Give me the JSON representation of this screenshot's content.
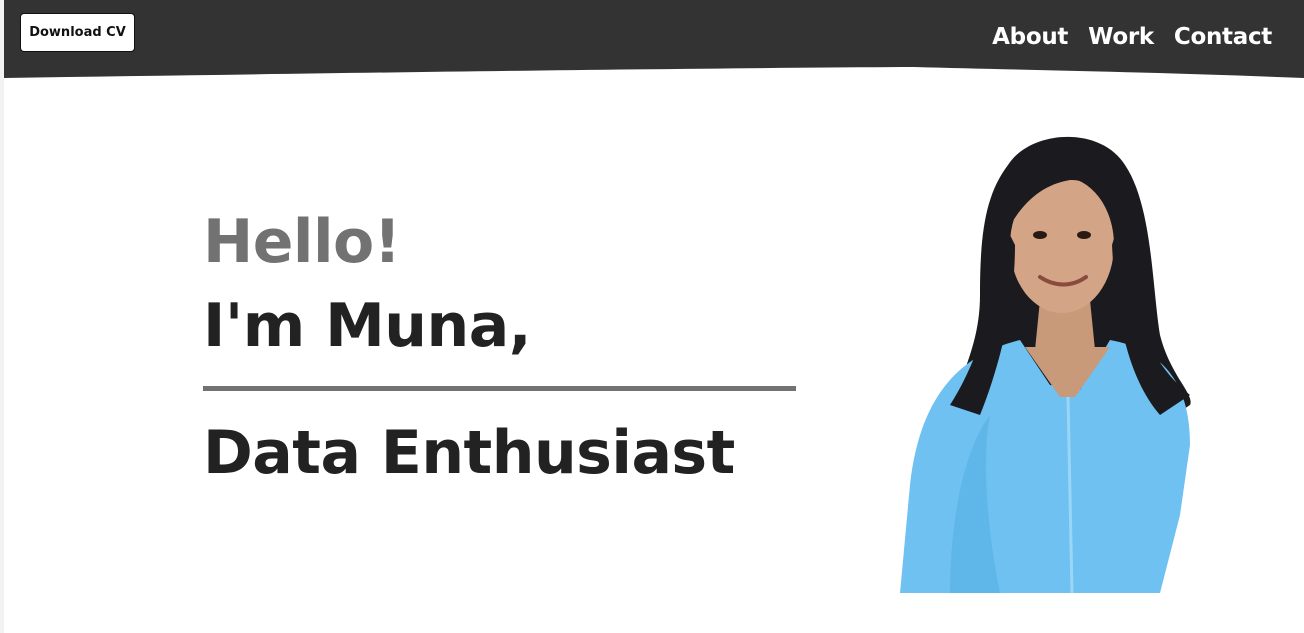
{
  "header": {
    "cv_button_label": "Download CV",
    "nav": [
      {
        "label": "About"
      },
      {
        "label": "Work"
      },
      {
        "label": "Contact"
      }
    ]
  },
  "hero": {
    "greeting": "Hello!",
    "intro": "I'm Muna,",
    "role": "Data Enthusiast"
  },
  "colors": {
    "header_bg": "#333333",
    "greeting_text": "#727272",
    "heading_text": "#222222",
    "divider": "#727272",
    "sweater": "#6EC1F0",
    "hair": "#1b1b1f"
  }
}
